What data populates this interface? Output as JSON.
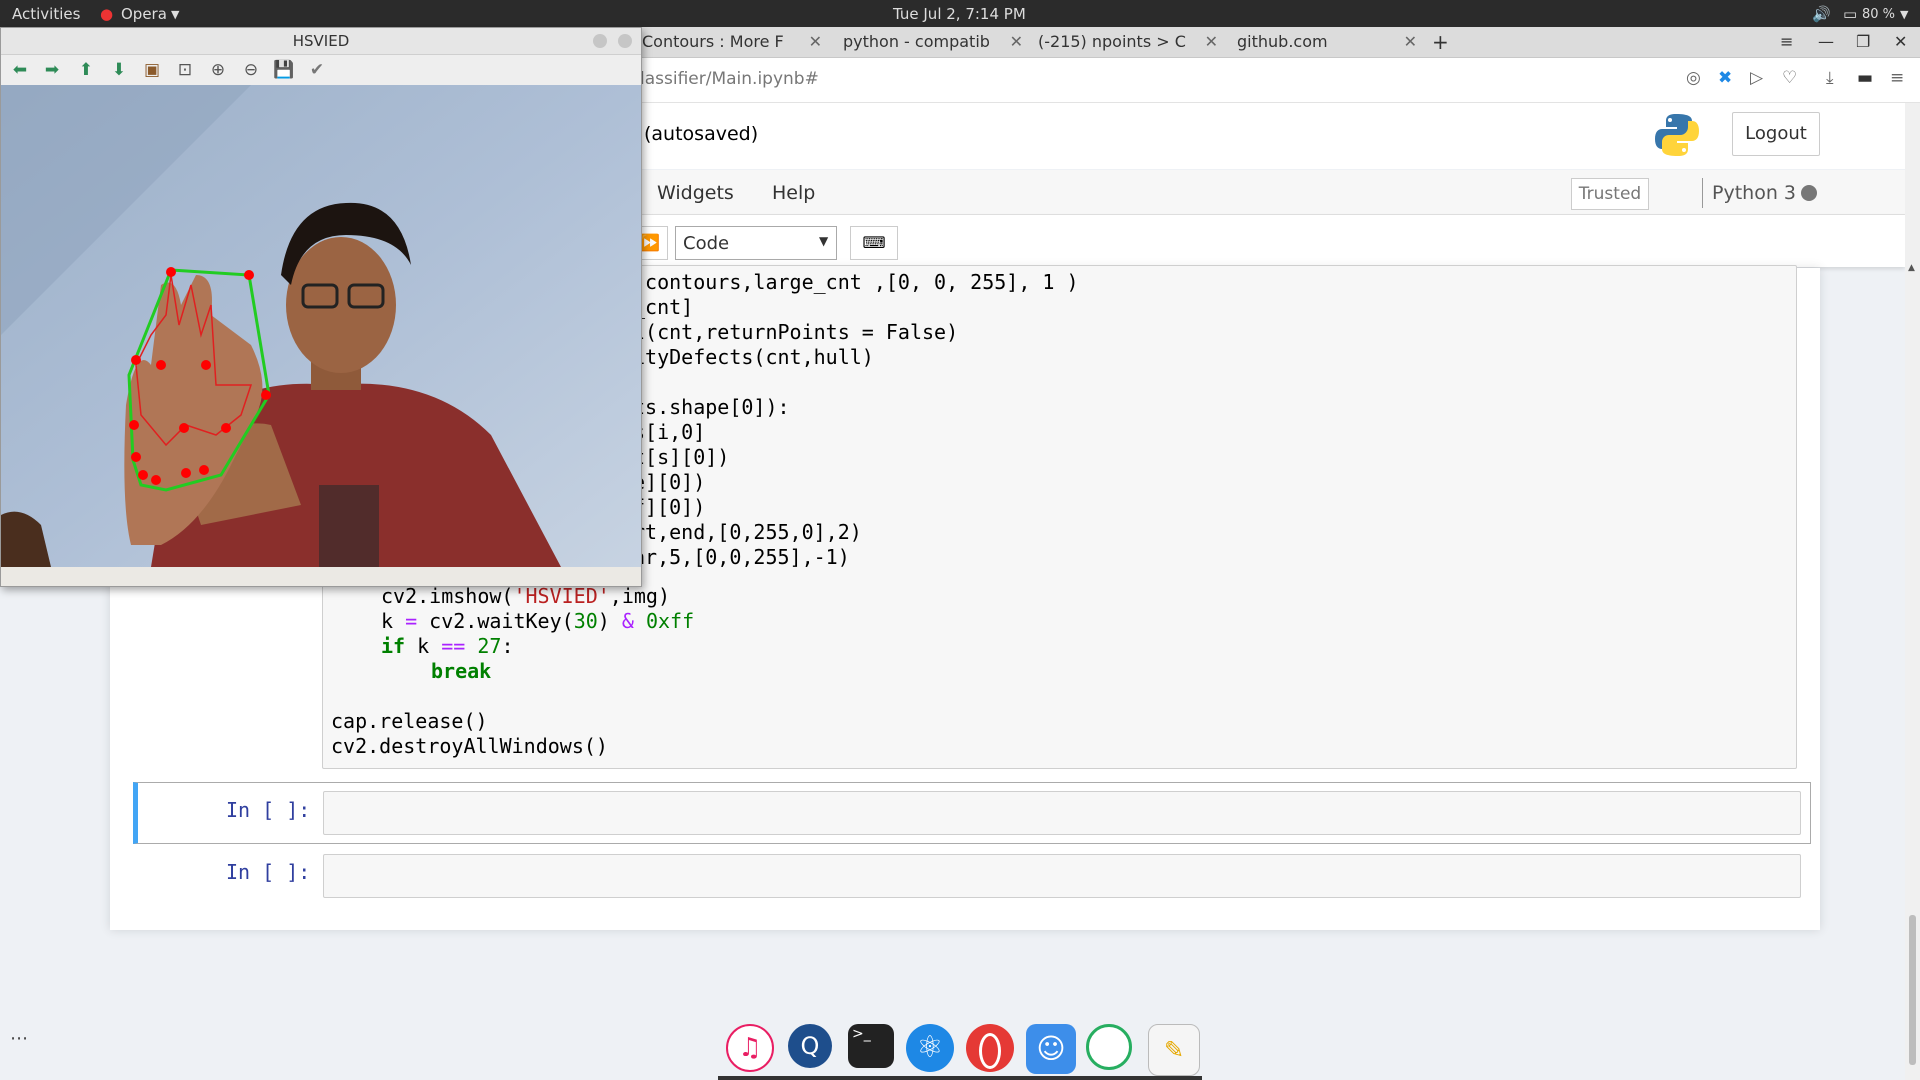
{
  "topbar": {
    "activities": "Activities",
    "app": "Opera",
    "clock": "Tue Jul  2,  7:14 PM",
    "battery": "80 %"
  },
  "tabs": [
    {
      "label": "Contours : More F"
    },
    {
      "label": "python - compatib"
    },
    {
      "label": "(-215) npoints > C"
    },
    {
      "label": "github.com"
    }
  ],
  "address": {
    "url": "lassifier/Main.ipynb#"
  },
  "jupyter": {
    "autosaved": "(autosaved)",
    "logout": "Logout",
    "menu_widgets": "Widgets",
    "menu_help": "Help",
    "trusted": "Trusted",
    "kernel": "Python 3",
    "cell_type": "Code"
  },
  "code_lines": [
    ",contours,large_cnt ,[0, 0, 255], 1 )",
    "_cnt]",
    "l(cnt,returnPoints = False)",
    "ityDefects(cnt,hull)",
    "",
    "ts.shape[0]):",
    "s[i,0]",
    "t[s][0])",
    "e][0])",
    "f][0])",
    "rt,end,[0,255,0],2)",
    "ar,5,[0,0,255],-1)"
  ],
  "prompts": {
    "in1": "In [ ]:",
    "in2": "In [ ]:"
  },
  "opencv_window": {
    "title": "HSVIED"
  },
  "dock": {
    "apps": [
      "itunes-icon",
      "search-icon",
      "terminal-icon",
      "atom-icon",
      "opera-icon",
      "finder-icon",
      "refresh-icon",
      "text-editor-icon"
    ]
  }
}
